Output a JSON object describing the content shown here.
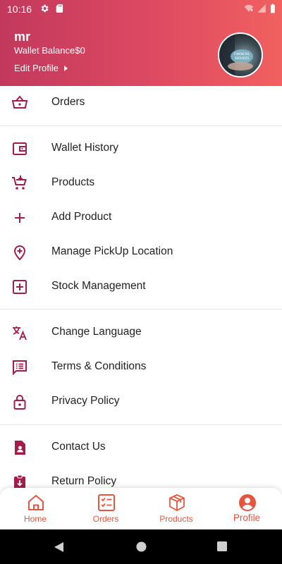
{
  "status_bar": {
    "time": "10:16"
  },
  "profile": {
    "name": "mr",
    "wallet_label": "Wallet Balance",
    "wallet_value": "$0",
    "edit_profile": "Edit Profile",
    "avatar_text": "FINANCIAL SERVICES"
  },
  "menu": {
    "orders": "Orders",
    "wallet_history": "Wallet History",
    "products": "Products",
    "add_product": "Add Product",
    "manage_pickup": "Manage PickUp Location",
    "stock_management": "Stock Management",
    "change_language": "Change Language",
    "terms": "Terms & Conditions",
    "privacy": "Privacy Policy",
    "contact": "Contact Us",
    "return_policy": "Return Policy"
  },
  "bottom_nav": {
    "home": "Home",
    "orders": "Orders",
    "products": "Products",
    "profile": "Profile",
    "active": "profile"
  },
  "colors": {
    "header_start": "#c2385c",
    "header_end": "#f0615f",
    "menu_icon": "#a51c4a",
    "nav_accent": "#e8553f"
  },
  "icons": {
    "orders": "basket-icon",
    "wallet_history": "wallet-icon",
    "products": "cart-icon",
    "add_product": "plus-icon",
    "manage_pickup": "location-add-icon",
    "stock_management": "plus-box-icon",
    "change_language": "translate-icon",
    "terms": "terms-icon",
    "privacy": "lock-icon",
    "contact": "contact-icon",
    "return_policy": "return-icon"
  }
}
